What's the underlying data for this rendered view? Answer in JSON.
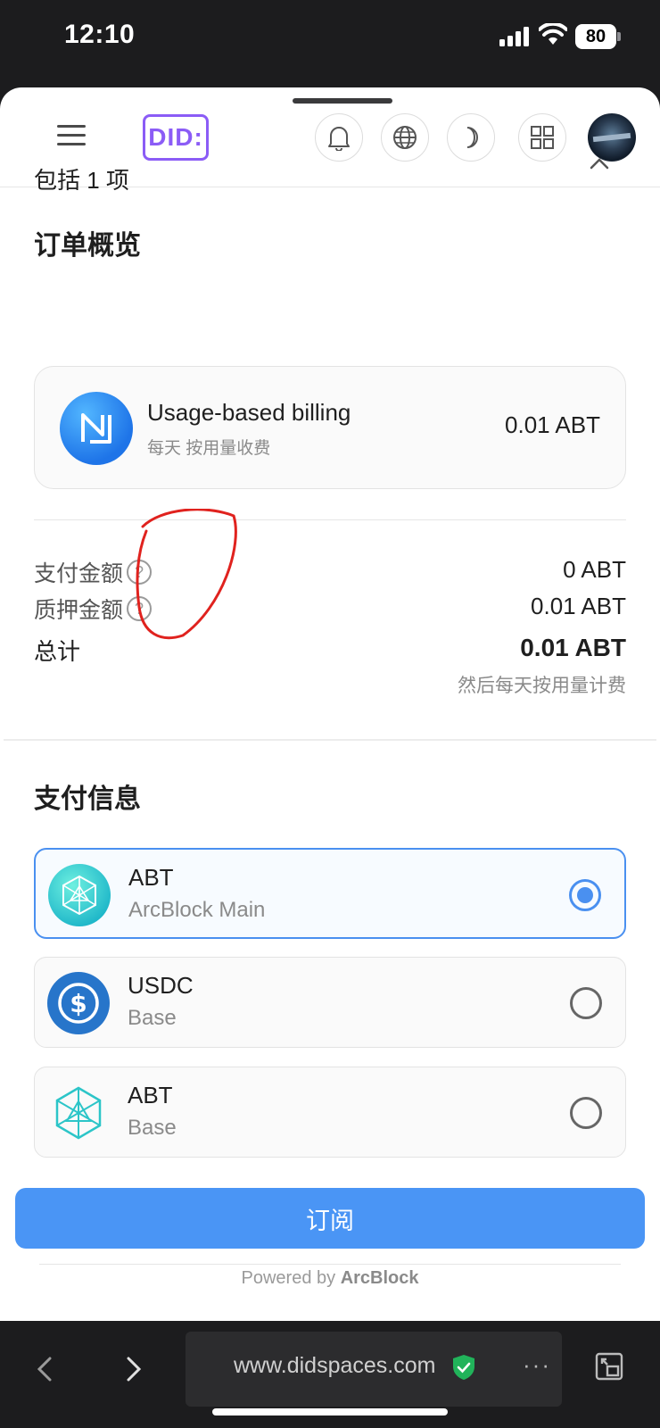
{
  "status_bar": {
    "time": "12:10",
    "battery": "80"
  },
  "header": {
    "logo": "DID:",
    "icons": [
      "menu-icon",
      "bell-icon",
      "globe-icon",
      "moon-icon",
      "apps-grid-icon",
      "avatar"
    ]
  },
  "order": {
    "title": "订单概览",
    "includes": "包括 1 项",
    "item": {
      "name": "Usage-based billing",
      "sub": "每天 按用量收费",
      "price": "0.01 ABT"
    },
    "pay_amount_label": "支付金额",
    "pay_amount_value": "0 ABT",
    "stake_amount_label": "质押金额",
    "stake_amount_value": "0.01 ABT",
    "total_label": "总计",
    "total_value": "0.01 ABT",
    "total_note": "然后每天按用量计费"
  },
  "payment": {
    "title": "支付信息",
    "methods": [
      {
        "name": "ABT",
        "network": "ArcBlock Main",
        "selected": true
      },
      {
        "name": "USDC",
        "network": "Base",
        "selected": false
      },
      {
        "name": "ABT",
        "network": "Base",
        "selected": false
      }
    ]
  },
  "subscribe_label": "订阅",
  "powered_prefix": "Powered by",
  "powered_brand": "ArcBlock",
  "browser": {
    "url": "www.didspaces.com",
    "more": "···"
  },
  "colors": {
    "accent": "#4a95f5",
    "brand_purple": "#8b5cf6",
    "annotation": "#e0221e"
  }
}
